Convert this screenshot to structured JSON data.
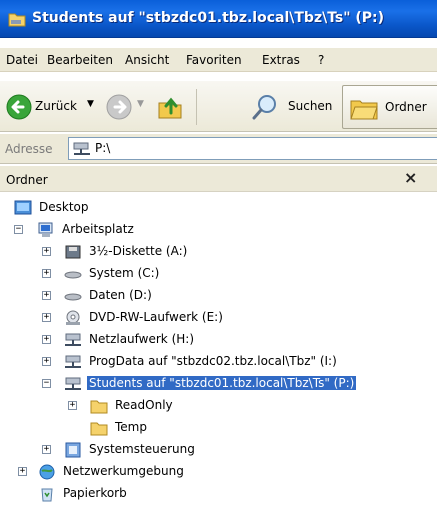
{
  "window": {
    "title": "Students auf \"stbzdc01.tbz.local\\Tbz\\Ts\" (P:)"
  },
  "menu": [
    "Datei",
    "Bearbeiten",
    "Ansicht",
    "Favoriten",
    "Extras",
    "?"
  ],
  "toolbar": {
    "back_label": "Zurück",
    "search_label": "Suchen",
    "folders_label": "Ordner"
  },
  "address": {
    "label": "Adresse",
    "value": "P:\\"
  },
  "pane": {
    "title": "Ordner",
    "close": "×"
  },
  "tree": [
    {
      "label": "Desktop",
      "icon": "desktop-icon"
    },
    {
      "label": "Arbeitsplatz",
      "icon": "computer-icon",
      "expander": "−"
    },
    {
      "label": "3½-Diskette (A:)",
      "icon": "floppy-icon",
      "expander": "+"
    },
    {
      "label": "System (C:)",
      "icon": "hard-drive-icon",
      "expander": "+"
    },
    {
      "label": "Daten (D:)",
      "icon": "hard-drive-icon",
      "expander": "+"
    },
    {
      "label": "DVD-RW-Laufwerk (E:)",
      "icon": "dvd-drive-icon",
      "expander": "+"
    },
    {
      "label": "Netzlaufwerk (H:)",
      "icon": "network-drive-icon",
      "expander": "+"
    },
    {
      "label": "ProgData auf \"stbzdc02.tbz.local\\Tbz\" (I:)",
      "icon": "network-drive-icon",
      "expander": "+"
    },
    {
      "label": "Students auf \"stbzdc01.tbz.local\\Tbz\\Ts\" (P:)",
      "icon": "network-drive-icon",
      "expander": "−",
      "selected": true
    },
    {
      "label": "ReadOnly",
      "icon": "folder-icon",
      "expander": "+"
    },
    {
      "label": "Temp",
      "icon": "folder-icon"
    },
    {
      "label": "Systemsteuerung",
      "icon": "control-panel-icon",
      "expander": "+"
    },
    {
      "label": "Netzwerkumgebung",
      "icon": "network-places-icon",
      "expander": "+"
    },
    {
      "label": "Papierkorb",
      "icon": "recycle-bin-icon"
    }
  ]
}
